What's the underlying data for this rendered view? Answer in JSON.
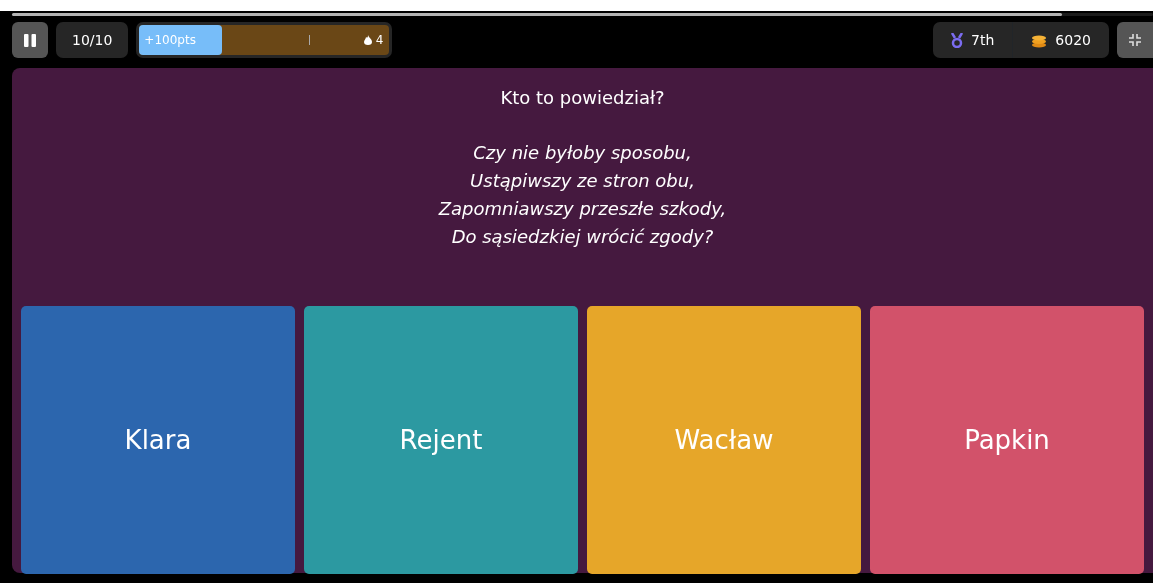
{
  "progress": {
    "level": 0.92
  },
  "top_bar": {
    "question_counter": "10/10",
    "streak": {
      "points": "+100pts",
      "level": 0.33,
      "count": "4"
    },
    "rank": "7th",
    "coins": "6020"
  },
  "question": {
    "title": "Kto to powiedział?",
    "quote_lines": [
      "Czy nie byłoby sposobu,",
      "Ustąpiwszy ze stron obu,",
      "Zapomniawszy przeszłe szkody,",
      "Do sąsiedzkiej wrócić zgody?"
    ]
  },
  "answers": [
    {
      "label": "Klara",
      "color": "#2c66ae"
    },
    {
      "label": "Rejent",
      "color": "#2c99a1"
    },
    {
      "label": "Wacław",
      "color": "#e6a629"
    },
    {
      "label": "Papkin",
      "color": "#d2526a"
    }
  ]
}
